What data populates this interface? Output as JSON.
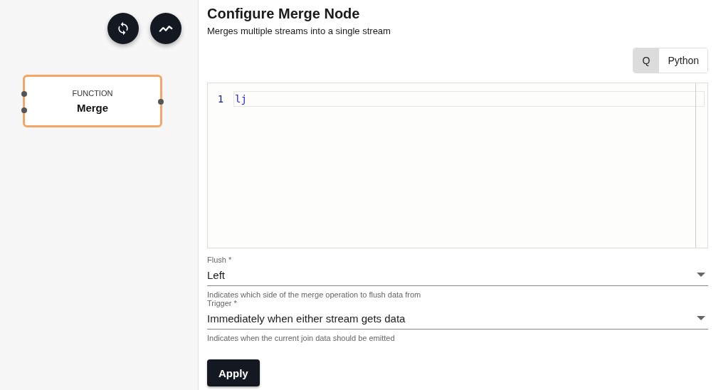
{
  "canvas": {
    "node": {
      "type": "FUNCTION",
      "name": "Merge"
    }
  },
  "panel": {
    "title": "Configure Merge Node",
    "subtitle": "Merges multiple streams into a single stream",
    "languages": [
      {
        "label": "Q",
        "selected": true
      },
      {
        "label": "Python",
        "selected": false
      }
    ],
    "editor": {
      "lines": [
        {
          "number": "1",
          "code": "lj"
        }
      ]
    },
    "fields": [
      {
        "label": "Flush *",
        "value": "Left",
        "helper": "Indicates which side of the merge operation to flush data from"
      },
      {
        "label": "Trigger *",
        "value": "Immediately when either stream gets data",
        "helper": "Indicates when the current join data should be emitted"
      }
    ],
    "apply": "Apply"
  }
}
